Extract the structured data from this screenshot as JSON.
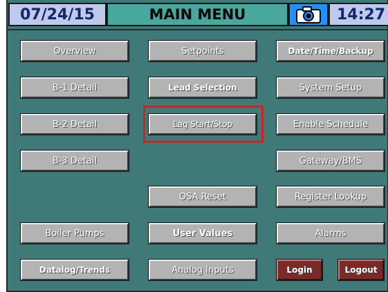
{
  "header": {
    "date": "07/24/15",
    "title": "MAIN MENU",
    "time": "14:27",
    "camera_icon": "camera-icon"
  },
  "buttons": {
    "overview": "Overview",
    "b1_detail": "B-1 Detail",
    "b2_detail": "B-2 Detail",
    "b3_detail": "B-3 Detail",
    "boiler_pumps": "Boiler Pumps",
    "datalog_trends": "Datalog/Trends",
    "setpoints": "Setpoints",
    "lead_selection": "Lead Selection",
    "lag_start_stop": "Lag Start/Stop",
    "osa_reset": "OSA Reset",
    "user_values": "User Values",
    "analog_inputs": "Analog Inputs",
    "date_time_backup": "Date/Time/Backup",
    "system_setup": "System Setup",
    "enable_schedule": "Enable Schedule",
    "gateway_bms": "Gateway/BMS",
    "register_lookup": "Register Lookup",
    "alarms": "Alarms",
    "login": "Login",
    "logout": "Logout"
  },
  "colors": {
    "panel_background": "#3f7a78",
    "button_face": "#b3b3b3",
    "login_logout_face": "#7a2a28",
    "header_date_time": "#bfc9ec",
    "header_title": "#4aa79d",
    "header_camera": "#1e90ff",
    "highlight_border": "#d42020"
  }
}
